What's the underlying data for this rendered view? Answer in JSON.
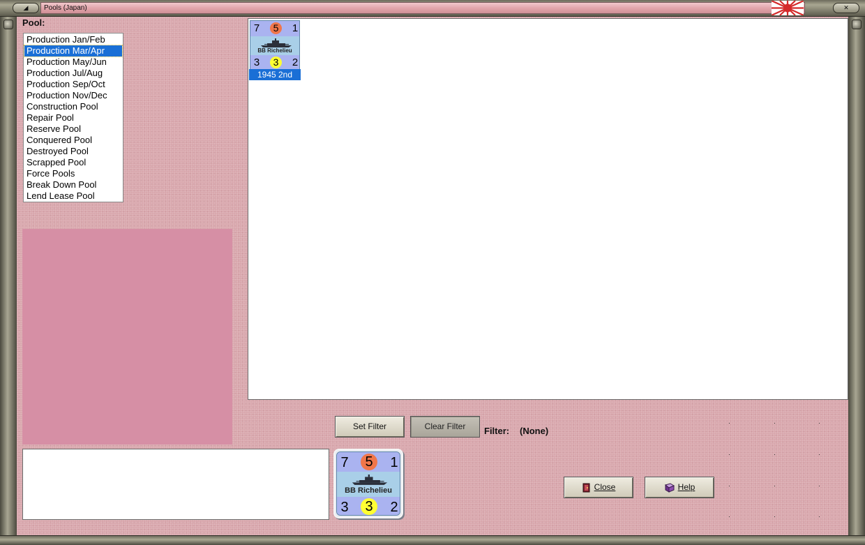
{
  "window": {
    "title": "Pools (Japan)",
    "menu_glyph": "◢",
    "close_glyph": "✕"
  },
  "pool_panel": {
    "label": "Pool:",
    "items": [
      "Production Jan/Feb",
      "Production Mar/Apr",
      "Production May/Jun",
      "Production Jul/Aug",
      "Production Sep/Oct",
      "Production Nov/Dec",
      "Construction Pool",
      "Repair Pool",
      "Reserve Pool",
      "Conquered Pool",
      "Destroyed Pool",
      "Scrapped Pool",
      "Force Pools",
      "Break Down Pool",
      "Lend Lease Pool"
    ],
    "selected_index": 1
  },
  "unit": {
    "top_left": "7",
    "top_center": "5",
    "top_right": "1",
    "name": "BB Richelieu",
    "bottom_left": "3",
    "bottom_center": "3",
    "bottom_right": "2",
    "year": "1945 2nd",
    "top_circle_color": "#f0764a",
    "bottom_circle_color": "#ffff33"
  },
  "filter": {
    "set_label": "Set Filter",
    "clear_label": "Clear Filter",
    "label": "Filter:",
    "value": "(None)"
  },
  "actions": {
    "close_label": "Close",
    "help_label": "Help"
  },
  "colors": {
    "background": "#d9a7ad",
    "pink_panel": "#d68fa5",
    "selection": "#1a6fd6"
  }
}
